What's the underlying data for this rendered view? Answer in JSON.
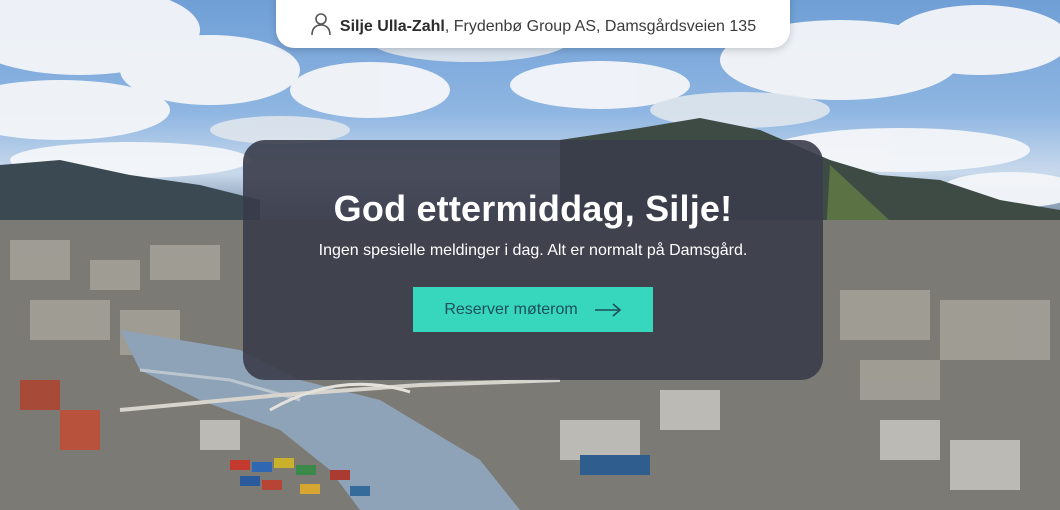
{
  "header": {
    "user_name": "Silje Ulla-Zahl",
    "user_details": ", Frydenbø Group AS, Damsgårdsveien 135",
    "icon": "person-icon"
  },
  "greeting": {
    "title": "God ettermiddag, Silje!",
    "message": "Ingen spesielle meldinger i dag. Alt er normalt på Damsgård.",
    "button_label": "Reserver møterom",
    "button_icon": "arrow-right-icon"
  },
  "colors": {
    "accent": "#36d7bd",
    "card_background": "#3a3c4a"
  }
}
